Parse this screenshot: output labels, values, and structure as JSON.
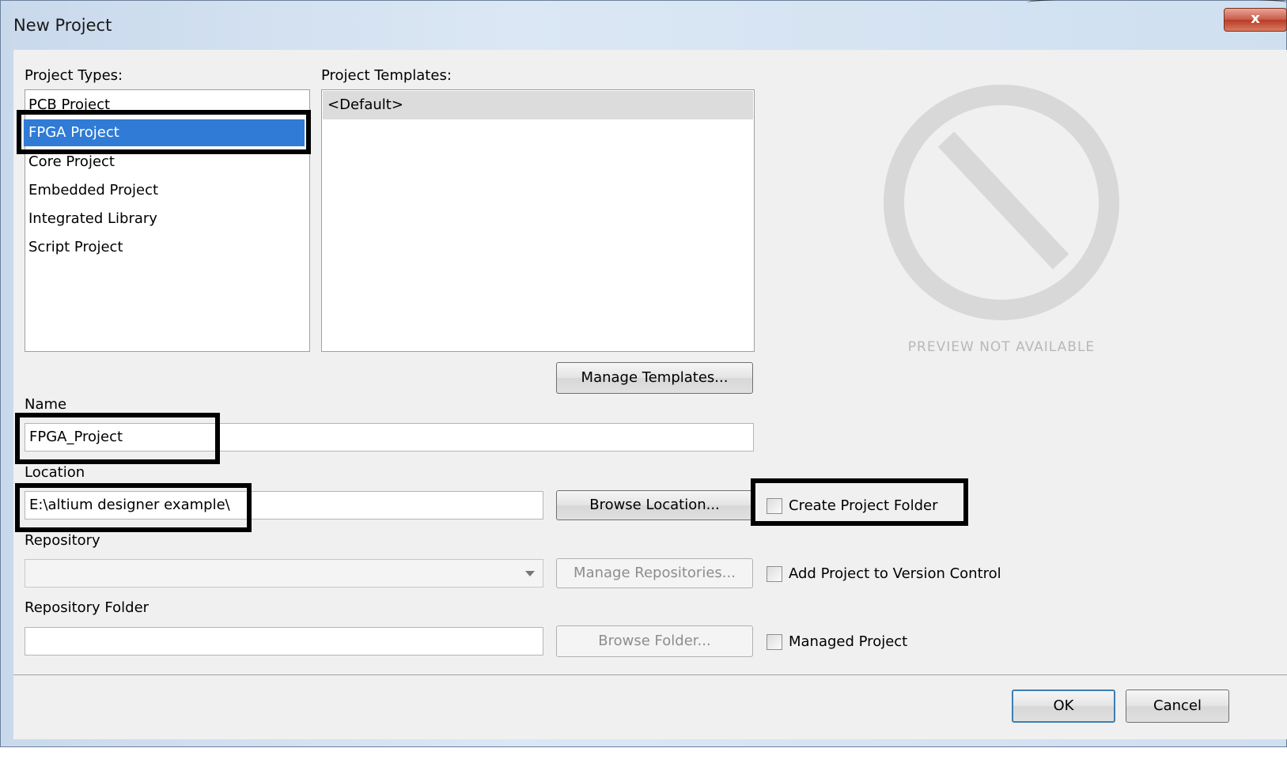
{
  "window": {
    "title": "New Project",
    "close_glyph": "x"
  },
  "project_types": {
    "label": "Project Types:",
    "items": [
      {
        "label": "PCB Project"
      },
      {
        "label": "FPGA Project"
      },
      {
        "label": "Core Project"
      },
      {
        "label": "Embedded Project"
      },
      {
        "label": "Integrated Library"
      },
      {
        "label": "Script Project"
      }
    ],
    "selected": "FPGA Project"
  },
  "project_templates": {
    "label": "Project Templates:",
    "items": [
      {
        "label": "<Default>"
      }
    ]
  },
  "manage_templates_button": "Manage Templates...",
  "preview": {
    "text": "PREVIEW NOT AVAILABLE",
    "icon": "no-preview-icon"
  },
  "name": {
    "label": "Name",
    "value": "FPGA_Project"
  },
  "location": {
    "label": "Location",
    "value": "E:\\altium designer example\\",
    "browse_button": "Browse Location...",
    "create_folder_label": "Create Project Folder"
  },
  "repository": {
    "label": "Repository",
    "value": "",
    "manage_button": "Manage Repositories...",
    "version_control_label": "Add Project to Version Control"
  },
  "repository_folder": {
    "label": "Repository Folder",
    "value": "",
    "browse_button": "Browse Folder...",
    "managed_label": "Managed Project"
  },
  "footer": {
    "ok": "OK",
    "cancel": "Cancel"
  },
  "colors": {
    "selection": "#2f7bd6",
    "highlight_border": "#000000",
    "close_button": "#c75a46"
  }
}
